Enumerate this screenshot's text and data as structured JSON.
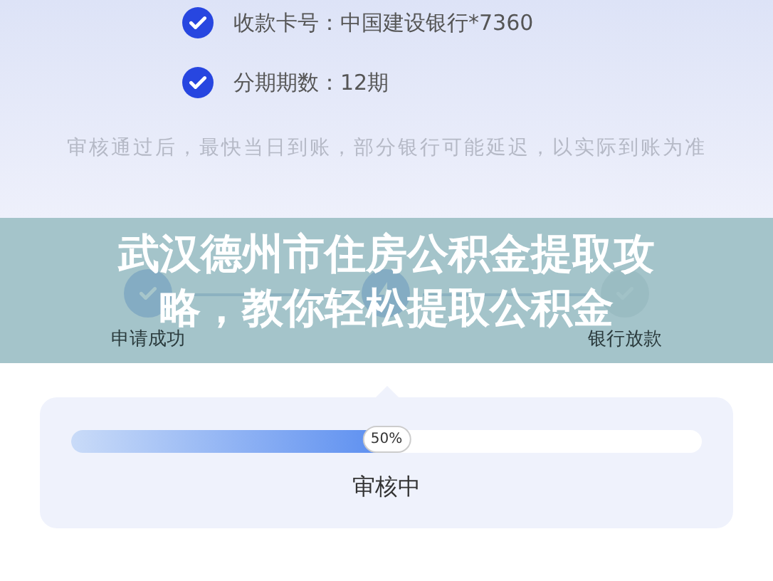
{
  "details": [
    {
      "label": "收款卡号：中国建设银行*7360",
      "checked": true
    },
    {
      "label": "分期期数：12期",
      "checked": true
    }
  ],
  "note": "审核通过后，最快当日到账，部分银行可能延迟，以实际到账为准",
  "steps": [
    {
      "label": "申请成功",
      "kind": "done"
    },
    {
      "kind": "active"
    },
    {
      "label": "银行放款",
      "kind": "pending"
    }
  ],
  "banner": {
    "title": "武汉德州市住房公积金提取攻略，教你轻松提取公积金"
  },
  "progress": {
    "level": 0.5,
    "reading": "50%",
    "status": "审核中"
  }
}
